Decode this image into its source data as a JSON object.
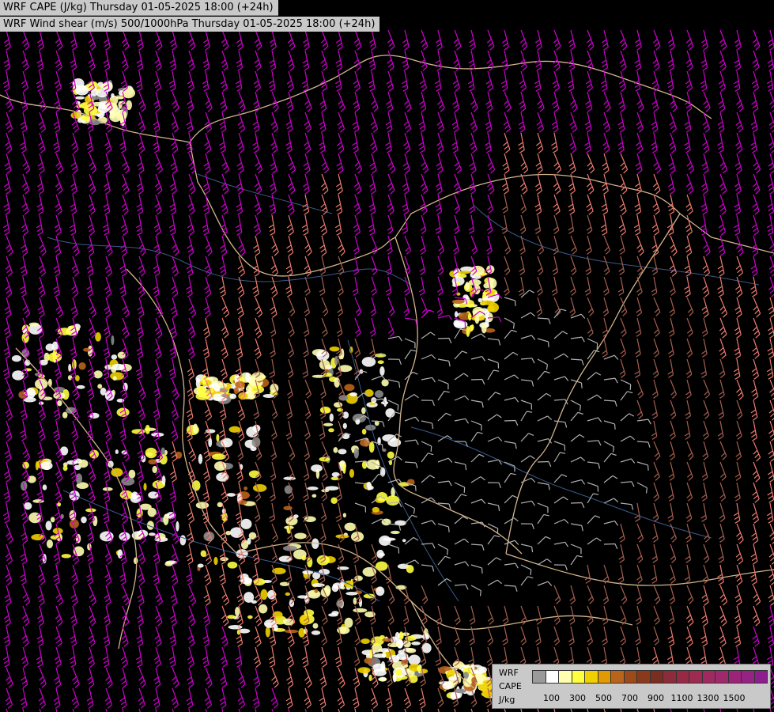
{
  "header": {
    "line1": "WRF CAPE (J/kg) Thursday 01-05-2025 18:00 (+24h)",
    "line2": "WRF Wind shear (m/s) 500/1000hPa Thursday 01-05-2025 18:00 (+24h)"
  },
  "legend": {
    "label_lines": [
      "WRF",
      "CAPE",
      "J/kg"
    ],
    "colors": [
      "#9a9a9a",
      "#ffffff",
      "#ffffb0",
      "#ffff40",
      "#f0d000",
      "#e29a00",
      "#b8641a",
      "#9c4a1a",
      "#8a3a1a",
      "#7a2e22",
      "#8c2c3a",
      "#962a44",
      "#9c2a52",
      "#a02a60",
      "#a0286c",
      "#9c2478",
      "#962284",
      "#8c1e8e"
    ],
    "tick_labels": [
      "100",
      "300",
      "500",
      "700",
      "900",
      "1100",
      "1300",
      "1500"
    ]
  },
  "map_colors": {
    "background": "#000000",
    "borders": "#d2b48c",
    "rivers": "#3a5a8a",
    "barbs_weak": "#b0b0b0",
    "barbs_mid": "#a86050",
    "barbs_strong": "#f07c70",
    "barbs_extreme": "#d000d0"
  }
}
